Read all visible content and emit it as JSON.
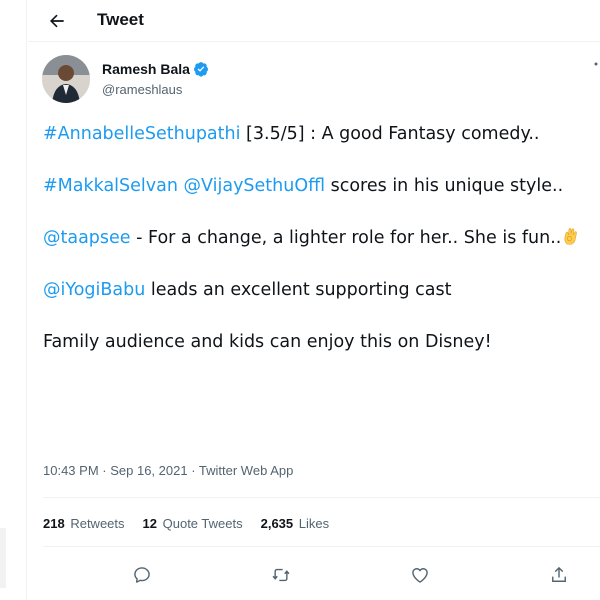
{
  "header": {
    "title": "Tweet",
    "back_icon": "arrow-left-icon"
  },
  "author": {
    "name": "Ramesh Bala",
    "handle": "@rameshlaus",
    "verified_icon": "verified-badge-icon",
    "more_icon": "more-horizontal-icon"
  },
  "tweet": {
    "p1": {
      "hashtag": "#AnnabelleSethupathi",
      "text": " [3.5/5] : A good Fantasy comedy.."
    },
    "p2": {
      "hashtag": "#MakkalSelvan",
      "mention": "@VijaySethuOffl",
      "text": " scores in his unique style.."
    },
    "p3": {
      "mention": "@taapsee",
      "text": " - For a change, a lighter role for her.. She is fun..",
      "emoji": "ok-hand-emoji"
    },
    "p4": {
      "mention": "@iYogiBabu",
      "text": " leads an excellent supporting cast"
    },
    "p5": {
      "text": "Family audience and kids can enjoy this on Disney!"
    }
  },
  "meta": {
    "time": "10:43 PM",
    "date": "Sep 16, 2021",
    "source": "Twitter Web App"
  },
  "stats": {
    "retweets": {
      "count": "218",
      "label": "Retweets"
    },
    "quotes": {
      "count": "12",
      "label": "Quote Tweets"
    },
    "likes": {
      "count": "2,635",
      "label": "Likes"
    }
  },
  "actions": [
    "reply-icon",
    "retweet-icon",
    "like-icon",
    "share-icon"
  ],
  "colors": {
    "link": "#1d9bf0",
    "text": "#0f1419",
    "muted": "#536471",
    "border": "#eff3f4"
  }
}
